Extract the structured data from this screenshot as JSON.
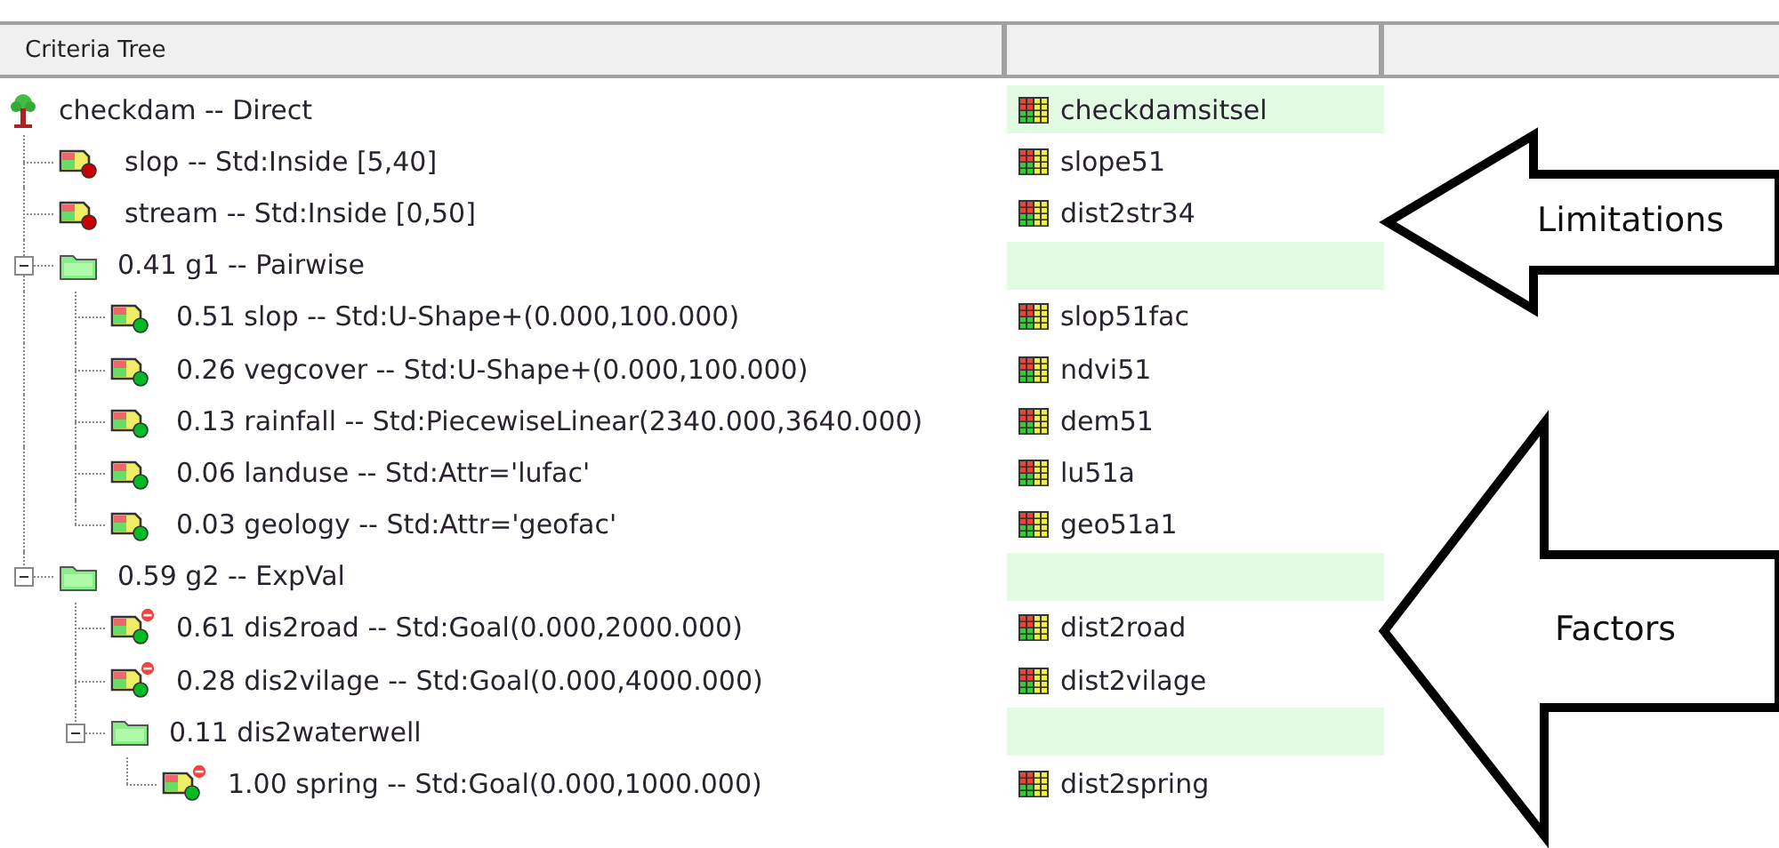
{
  "header": {
    "column_1": "Criteria Tree"
  },
  "tree": [
    {
      "kind": "root",
      "label": "checkdam -- Direct",
      "layer": "checkdamsitsel",
      "children": [
        {
          "kind": "limitation",
          "label": "slop -- Std:Inside [5,40]",
          "layer": "slope51"
        },
        {
          "kind": "limitation",
          "label": "stream -- Std:Inside [0,50]",
          "layer": "dist2str34"
        },
        {
          "kind": "group",
          "label": "0.41 g1 -- Pairwise",
          "expanded": true,
          "children": [
            {
              "kind": "factor",
              "cost": false,
              "label": "0.51 slop -- Std:U-Shape+(0.000,100.000)",
              "layer": "slop51fac"
            },
            {
              "kind": "factor",
              "cost": false,
              "label": "0.26 vegcover -- Std:U-Shape+(0.000,100.000)",
              "layer": "ndvi51"
            },
            {
              "kind": "factor",
              "cost": false,
              "label": "0.13 rainfall -- Std:PiecewiseLinear(2340.000,3640.000)",
              "layer": "dem51"
            },
            {
              "kind": "factor",
              "cost": false,
              "label": "0.06 landuse -- Std:Attr='lufac'",
              "layer": "lu51a"
            },
            {
              "kind": "factor",
              "cost": false,
              "label": "0.03 geology -- Std:Attr='geofac'",
              "layer": "geo51a1"
            }
          ]
        },
        {
          "kind": "group",
          "label": "0.59 g2 -- ExpVal",
          "expanded": true,
          "children": [
            {
              "kind": "factor",
              "cost": true,
              "label": "0.61 dis2road -- Std:Goal(0.000,2000.000)",
              "layer": "dist2road"
            },
            {
              "kind": "factor",
              "cost": true,
              "label": "0.28 dis2vilage -- Std:Goal(0.000,4000.000)",
              "layer": "dist2vilage"
            },
            {
              "kind": "group",
              "label": "0.11 dis2waterwell",
              "expanded": true,
              "children": [
                {
                  "kind": "factor",
                  "cost": true,
                  "label": "1.00 spring -- Std:Goal(0.000,1000.000)",
                  "layer": "dist2spring"
                }
              ]
            }
          ]
        }
      ]
    }
  ],
  "annotations": [
    {
      "label": "Limitations"
    },
    {
      "label": "Factors"
    }
  ]
}
